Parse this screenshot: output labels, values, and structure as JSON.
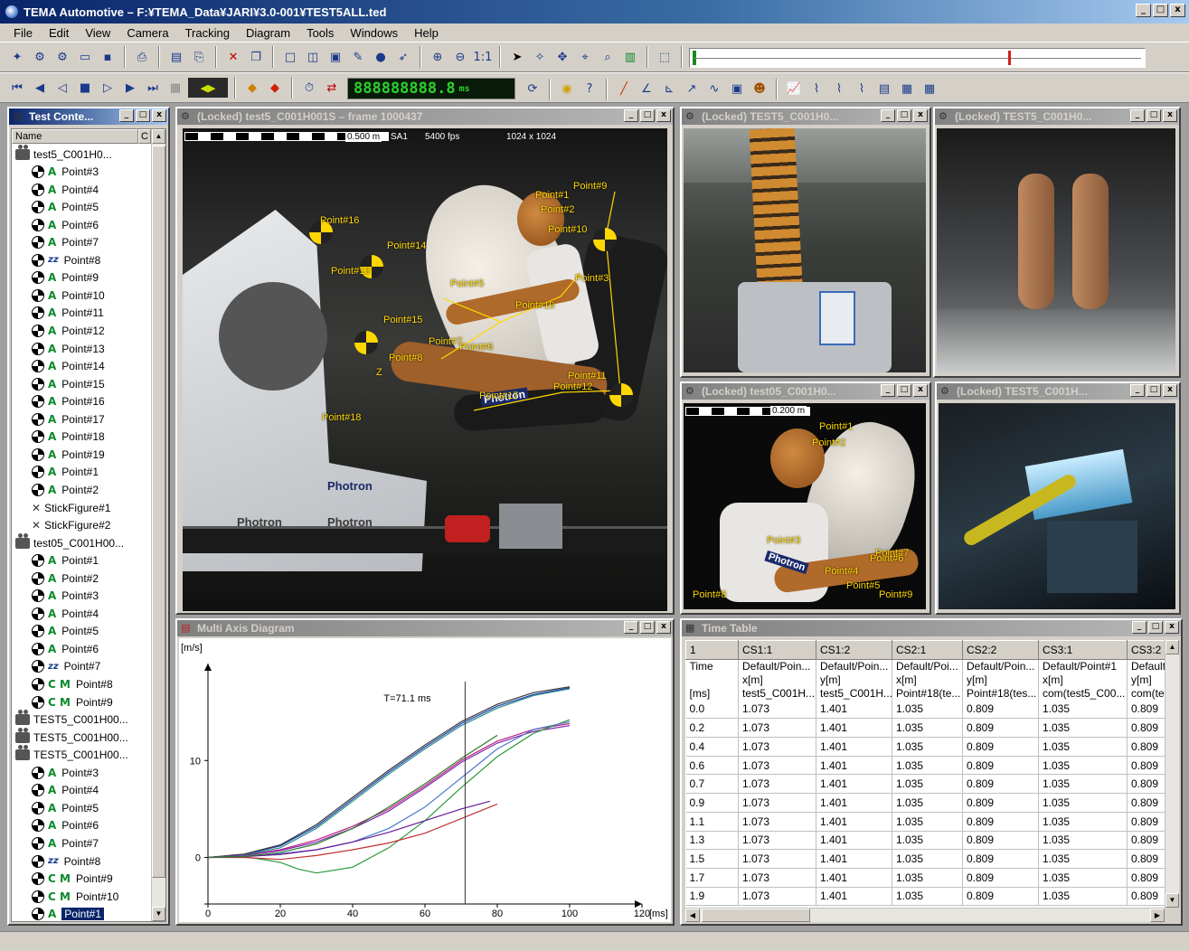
{
  "window": {
    "title": "TEMA Automotive – F:¥TEMA_Data¥JARI¥3.0-001¥TEST5ALL.ted",
    "min": "_",
    "max": "□",
    "close": "x"
  },
  "menu": [
    "File",
    "Edit",
    "View",
    "Camera",
    "Tracking",
    "Diagram",
    "Tools",
    "Windows",
    "Help"
  ],
  "timecode": "888888888.8",
  "timecode_unit": "ms",
  "tree_panel": {
    "title": "Test Conte...",
    "column_header": "Name",
    "column_header2": "C",
    "items": [
      {
        "kind": "cam",
        "label": "test5_C001H0...",
        "indent": 0
      },
      {
        "kind": "A",
        "label": "Point#3",
        "indent": 1
      },
      {
        "kind": "A",
        "label": "Point#4",
        "indent": 1
      },
      {
        "kind": "A",
        "label": "Point#5",
        "indent": 1
      },
      {
        "kind": "A",
        "label": "Point#6",
        "indent": 1
      },
      {
        "kind": "A",
        "label": "Point#7",
        "indent": 1
      },
      {
        "kind": "zz",
        "label": "Point#8",
        "indent": 1
      },
      {
        "kind": "A",
        "label": "Point#9",
        "indent": 1
      },
      {
        "kind": "A",
        "label": "Point#10",
        "indent": 1
      },
      {
        "kind": "A",
        "label": "Point#11",
        "indent": 1
      },
      {
        "kind": "A",
        "label": "Point#12",
        "indent": 1
      },
      {
        "kind": "A",
        "label": "Point#13",
        "indent": 1
      },
      {
        "kind": "A",
        "label": "Point#14",
        "indent": 1
      },
      {
        "kind": "A",
        "label": "Point#15",
        "indent": 1
      },
      {
        "kind": "A",
        "label": "Point#16",
        "indent": 1
      },
      {
        "kind": "A",
        "label": "Point#17",
        "indent": 1
      },
      {
        "kind": "A",
        "label": "Point#18",
        "indent": 1
      },
      {
        "kind": "A",
        "label": "Point#19",
        "indent": 1
      },
      {
        "kind": "A",
        "label": "Point#1",
        "indent": 1
      },
      {
        "kind": "A",
        "label": "Point#2",
        "indent": 1
      },
      {
        "kind": "stick",
        "label": "StickFigure#1",
        "indent": 1
      },
      {
        "kind": "stick",
        "label": "StickFigure#2",
        "indent": 1
      },
      {
        "kind": "cam",
        "label": "test05_C001H00...",
        "indent": 0
      },
      {
        "kind": "A",
        "label": "Point#1",
        "indent": 1
      },
      {
        "kind": "A",
        "label": "Point#2",
        "indent": 1
      },
      {
        "kind": "A",
        "label": "Point#3",
        "indent": 1
      },
      {
        "kind": "A",
        "label": "Point#4",
        "indent": 1
      },
      {
        "kind": "A",
        "label": "Point#5",
        "indent": 1
      },
      {
        "kind": "A",
        "label": "Point#6",
        "indent": 1
      },
      {
        "kind": "zz",
        "label": "Point#7",
        "indent": 1
      },
      {
        "kind": "M",
        "label": "Point#8",
        "indent": 1
      },
      {
        "kind": "M",
        "label": "Point#9",
        "indent": 1
      },
      {
        "kind": "cam",
        "label": "TEST5_C001H00...",
        "indent": 0
      },
      {
        "kind": "cam",
        "label": "TEST5_C001H00...",
        "indent": 0
      },
      {
        "kind": "cam",
        "label": "TEST5_C001H00...",
        "indent": 0
      },
      {
        "kind": "A",
        "label": "Point#3",
        "indent": 1
      },
      {
        "kind": "A",
        "label": "Point#4",
        "indent": 1
      },
      {
        "kind": "A",
        "label": "Point#5",
        "indent": 1
      },
      {
        "kind": "A",
        "label": "Point#6",
        "indent": 1
      },
      {
        "kind": "A",
        "label": "Point#7",
        "indent": 1
      },
      {
        "kind": "zz",
        "label": "Point#8",
        "indent": 1
      },
      {
        "kind": "M",
        "label": "Point#9",
        "indent": 1
      },
      {
        "kind": "M",
        "label": "Point#10",
        "indent": 1
      },
      {
        "kind": "A",
        "label": "Point#1",
        "indent": 1,
        "selected": true
      }
    ]
  },
  "video_main": {
    "title": "(Locked) test5_C001H001S – frame 1000437",
    "scale": "0.500 m",
    "info1": "SA1",
    "info2": "5400 fps",
    "info3": "1024 x 1024",
    "labels": [
      "Point#9",
      "Point#1",
      "Point#2",
      "Point#16",
      "Point#14",
      "Point#10",
      "Point#13",
      "Point#5",
      "Point#3",
      "Point#19",
      "Point#15",
      "Point#7",
      "Point#6",
      "Point#8",
      "Point#11",
      "Point#12",
      "Point#17",
      "Point#18"
    ],
    "axis_z": "Z",
    "brand": "Photron"
  },
  "video_tr1": {
    "title": "(Locked) TEST5_C001H0..."
  },
  "video_tr2": {
    "title": "(Locked) TEST5_C001H0..."
  },
  "video_br1": {
    "title": "(Locked) test05_C001H0...",
    "scale": "0.200 m",
    "labels": [
      "Point#1",
      "Point#2",
      "Point#3",
      "Point#7",
      "Point#6",
      "Point#4",
      "Point#5",
      "Point#9",
      "Point#8"
    ],
    "brand": "Photron"
  },
  "video_br2": {
    "title": "(Locked) TEST5_C001H..."
  },
  "diagram": {
    "title": "Multi Axis Diagram",
    "cursor_label": "T=71.1  ms"
  },
  "chart_data": {
    "type": "line",
    "ylabel": "[m/s]",
    "xlabel": "[ms]",
    "xlim": [
      0,
      120
    ],
    "ylim": [
      -2,
      20
    ],
    "xticks": [
      0,
      20,
      40,
      60,
      80,
      100,
      120
    ],
    "yticks": [
      0,
      10
    ],
    "cursor_x": 71.1,
    "series": [
      {
        "color": "#1a3ea8",
        "x": [
          0,
          10,
          20,
          30,
          40,
          50,
          60,
          70,
          80,
          90,
          100
        ],
        "y": [
          0,
          0.3,
          1.2,
          3.2,
          6.0,
          8.8,
          11.4,
          13.8,
          15.6,
          16.8,
          17.5
        ]
      },
      {
        "color": "#2a8a8a",
        "x": [
          0,
          10,
          20,
          30,
          40,
          50,
          60,
          70,
          80,
          90,
          100
        ],
        "y": [
          0,
          0.25,
          1.0,
          3.0,
          5.8,
          8.6,
          11.2,
          13.6,
          15.4,
          16.7,
          17.4
        ]
      },
      {
        "color": "#3a3a3a",
        "x": [
          0,
          10,
          20,
          30,
          40,
          50,
          60,
          70,
          80,
          90,
          100
        ],
        "y": [
          0,
          0.35,
          1.3,
          3.4,
          6.2,
          9.0,
          11.6,
          14.0,
          15.8,
          17.0,
          17.6
        ]
      },
      {
        "color": "#c02080",
        "x": [
          0,
          10,
          20,
          30,
          40,
          50,
          60,
          70,
          80,
          90,
          100
        ],
        "y": [
          0,
          0.2,
          0.8,
          1.8,
          3.2,
          5.0,
          7.4,
          10.0,
          12.0,
          13.2,
          13.8
        ]
      },
      {
        "color": "#7a2ab0",
        "x": [
          0,
          10,
          20,
          30,
          40,
          50,
          60,
          70,
          80,
          90,
          100
        ],
        "y": [
          0,
          0.2,
          0.7,
          1.6,
          3.0,
          4.8,
          7.2,
          9.8,
          11.8,
          13.0,
          13.6
        ]
      },
      {
        "color": "#2a9a3a",
        "x": [
          0,
          10,
          20,
          25,
          30,
          40,
          50,
          60,
          70,
          80,
          90,
          100
        ],
        "y": [
          0,
          0.1,
          -0.5,
          -1.2,
          -1.6,
          -1.0,
          1.0,
          3.8,
          7.2,
          10.4,
          12.8,
          14.2
        ]
      },
      {
        "color": "#4a7ac8",
        "x": [
          0,
          10,
          20,
          30,
          40,
          50,
          60,
          70,
          80,
          90,
          100
        ],
        "y": [
          0,
          0.15,
          0.4,
          0.8,
          1.6,
          3.0,
          5.2,
          8.2,
          11.2,
          13.2,
          14.0
        ]
      },
      {
        "color": "#c03030",
        "x": [
          0,
          10,
          20,
          30,
          40,
          50,
          60,
          70,
          80
        ],
        "y": [
          0,
          0.0,
          -0.2,
          0.2,
          0.8,
          1.5,
          2.5,
          4.0,
          5.5
        ]
      },
      {
        "color": "#6a1a9a",
        "x": [
          0,
          10,
          20,
          30,
          40,
          50,
          60,
          70,
          78
        ],
        "y": [
          0,
          0.1,
          0.3,
          0.8,
          1.6,
          2.6,
          3.8,
          5.0,
          5.8
        ]
      },
      {
        "color": "#2a7a2a",
        "x": [
          0,
          10,
          20,
          30,
          40,
          50,
          60,
          70,
          80
        ],
        "y": [
          0,
          0.1,
          0.5,
          1.4,
          3.0,
          5.2,
          7.6,
          10.2,
          12.6
        ]
      }
    ]
  },
  "time_table": {
    "title": "Time Table",
    "header_row1": [
      "1",
      "CS1:1",
      "CS1:2",
      "CS2:1",
      "CS2:2",
      "CS3:1",
      "CS3:2"
    ],
    "header_row2": [
      "Time",
      "Default/Poin...",
      "Default/Poin...",
      "Default/Poi...",
      "Default/Poin...",
      "Default/Point#1",
      "Default/"
    ],
    "header_row3": [
      "",
      "x[m]",
      "y[m]",
      "x[m]",
      "y[m]",
      "x[m]",
      "y[m]"
    ],
    "header_row4": [
      "[ms]",
      "test5_C001H...",
      "test5_C001H...",
      "Point#18(te...",
      "Point#18(tes...",
      "com(test5_C00...",
      "com(te"
    ],
    "rows": [
      [
        "0.0",
        "1.073",
        "1.401",
        "1.035",
        "0.809",
        "1.035",
        "0.809"
      ],
      [
        "0.2",
        "1.073",
        "1.401",
        "1.035",
        "0.809",
        "1.035",
        "0.809"
      ],
      [
        "0.4",
        "1.073",
        "1.401",
        "1.035",
        "0.809",
        "1.035",
        "0.809"
      ],
      [
        "0.6",
        "1.073",
        "1.401",
        "1.035",
        "0.809",
        "1.035",
        "0.809"
      ],
      [
        "0.7",
        "1.073",
        "1.401",
        "1.035",
        "0.809",
        "1.035",
        "0.809"
      ],
      [
        "0.9",
        "1.073",
        "1.401",
        "1.035",
        "0.809",
        "1.035",
        "0.809"
      ],
      [
        "1.1",
        "1.073",
        "1.401",
        "1.035",
        "0.809",
        "1.035",
        "0.809"
      ],
      [
        "1.3",
        "1.073",
        "1.401",
        "1.035",
        "0.809",
        "1.035",
        "0.809"
      ],
      [
        "1.5",
        "1.073",
        "1.401",
        "1.035",
        "0.809",
        "1.035",
        "0.809"
      ],
      [
        "1.7",
        "1.073",
        "1.401",
        "1.035",
        "0.809",
        "1.035",
        "0.809"
      ],
      [
        "1.9",
        "1.073",
        "1.401",
        "1.035",
        "0.809",
        "1.035",
        "0.809"
      ]
    ]
  }
}
